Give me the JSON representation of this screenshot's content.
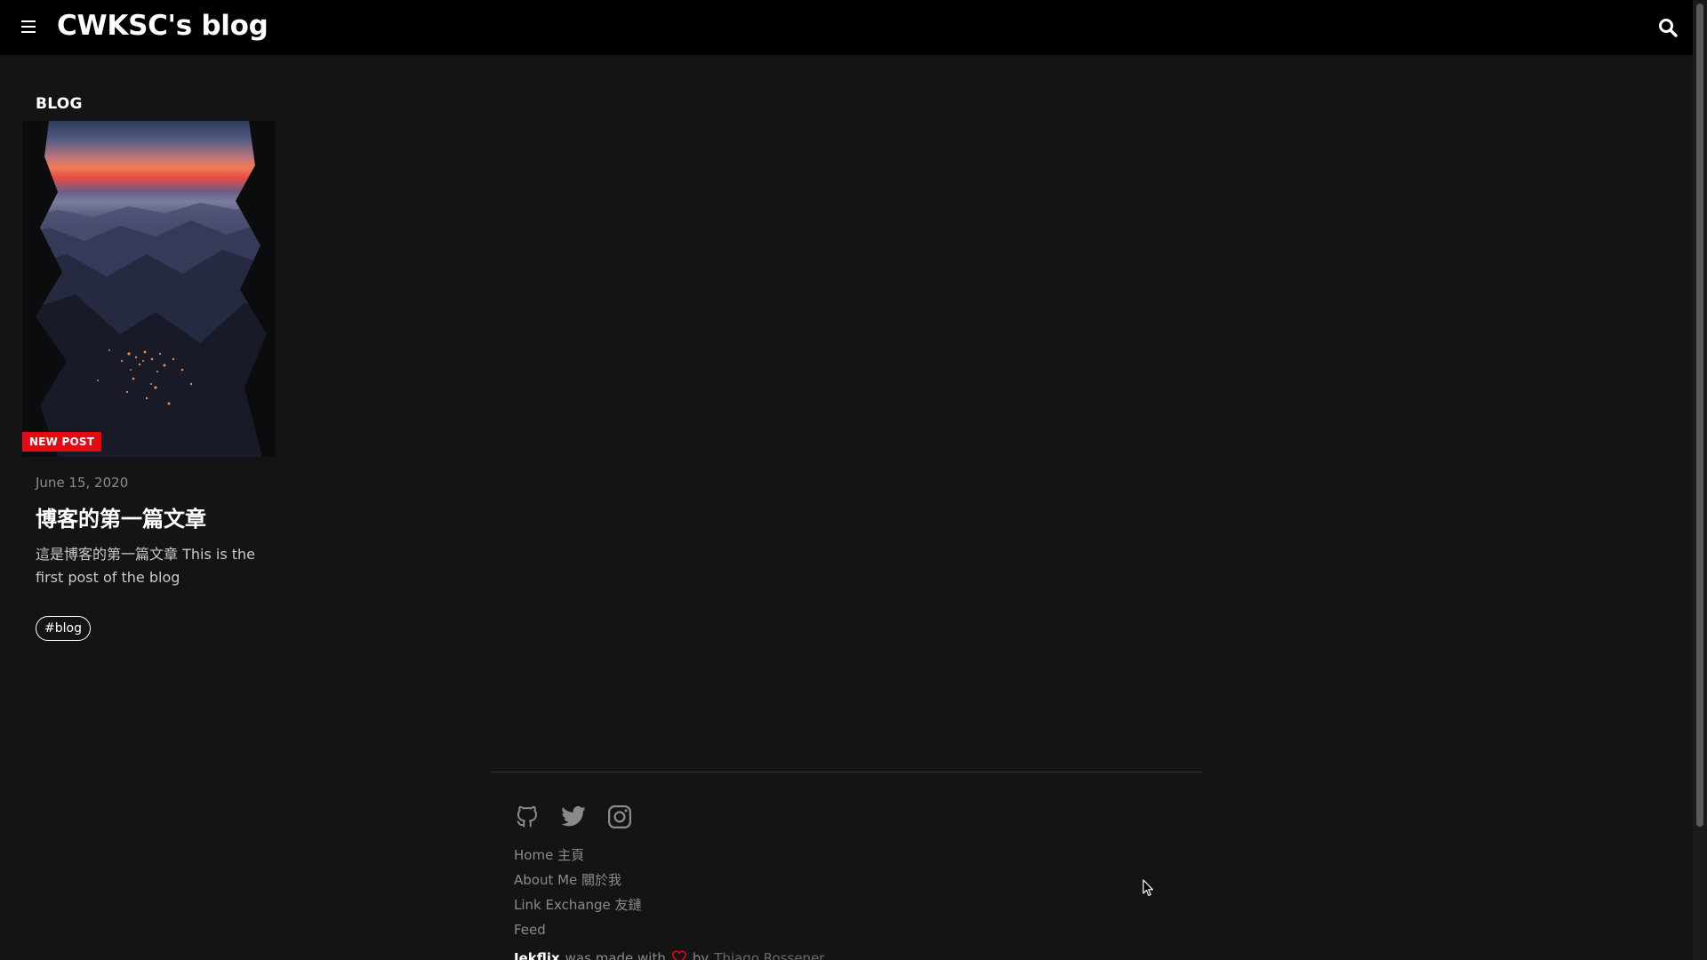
{
  "header": {
    "title": "CWKSC's blog"
  },
  "section": {
    "title": "BLOG"
  },
  "post": {
    "badge": "NEW POST",
    "date": "June 15, 2020",
    "title": "博客的第一篇文章",
    "excerpt": "這是博客的第一篇文章 This is the first post of the blog",
    "tag": "#blog"
  },
  "footer": {
    "social": [
      "github-icon",
      "twitter-icon",
      "instagram-icon"
    ],
    "links": [
      {
        "label": "Home 主頁"
      },
      {
        "label": "About Me 關於我"
      },
      {
        "label": "Link Exchange 友鏈"
      },
      {
        "label": "Feed"
      }
    ],
    "credits": {
      "brand": "Jekflix",
      "made_with": "was made with",
      "by": "by",
      "author": "Thiago Rossener"
    }
  },
  "colors": {
    "accent": "#e50914",
    "background": "#141414",
    "header": "#000000"
  }
}
